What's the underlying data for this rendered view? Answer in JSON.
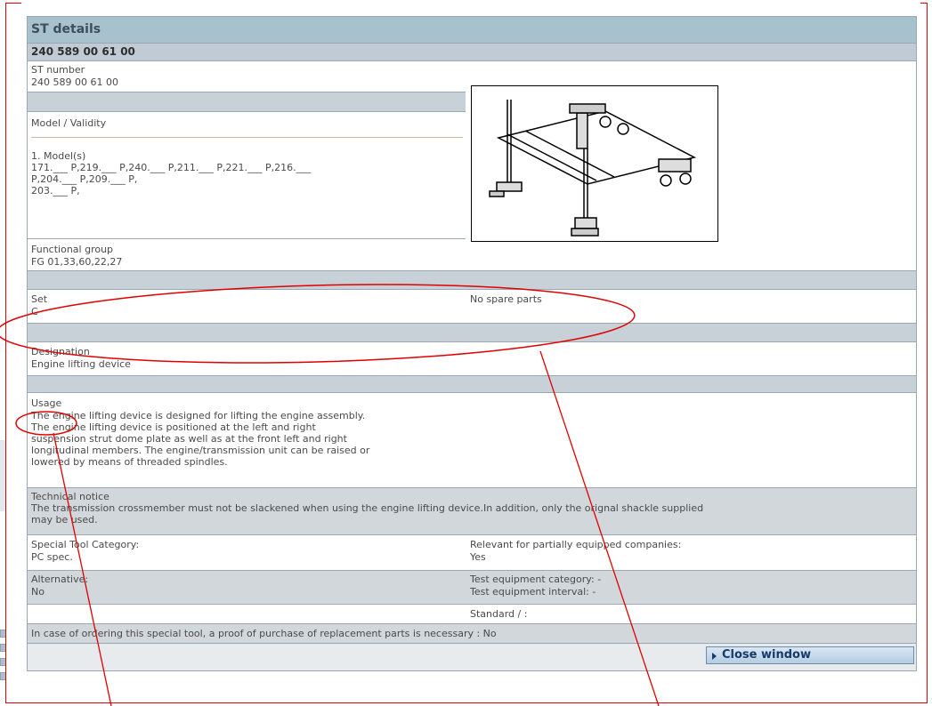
{
  "title": "ST details",
  "st_id": "240 589 00 61 00",
  "st_number": {
    "label": "ST number",
    "value": "240 589 00 61 00"
  },
  "model_validity": {
    "label": "Model / Validity"
  },
  "models": {
    "heading": "1. Model(s)",
    "lines": [
      "171.___ P,219.___ P,240.___ P,211.___ P,221.___ P,216.___",
      "P,204.___ P,209.___ P,",
      "203.___ P,"
    ]
  },
  "functional_group": {
    "label": "Functional group",
    "value": "FG 01,33,60,22,27"
  },
  "set": {
    "label": "Set",
    "value": "C",
    "spare_parts": "No spare parts"
  },
  "designation": {
    "label": "Designation",
    "value": "Engine lifting device"
  },
  "usage": {
    "label": "Usage",
    "text": "The engine lifting device is designed for lifting the engine assembly.\nThe engine lifting device is positioned at the left and right\nsuspension strut dome plate as well as at the front left and right\nlongitudinal members. The engine/transmission unit can be raised or\nlowered by means of threaded spindles."
  },
  "technical_notice": {
    "label": "Technical notice",
    "text": "The transmission crossmember must not be slackened when using the engine lifting device.In addition, only the orignal shackle supplied\nmay be used."
  },
  "category": {
    "label": "Special Tool Category:",
    "value": "PC spec."
  },
  "relevant": {
    "label": "Relevant for partially equipped companies:",
    "value": "Yes"
  },
  "alternative": {
    "label": "Alternative:",
    "value": "No"
  },
  "test_category": "Test equipment category: -",
  "test_interval": "Test equipment interval: -",
  "standard": "Standard / :",
  "ordering_note": "In case of ordering this special tool, a proof of purchase of replacement parts is necessary : No",
  "close_button": "Close window",
  "colors": {
    "annotation": "#e00000",
    "header": "#a7c2cc",
    "button": "#b4cde2"
  }
}
